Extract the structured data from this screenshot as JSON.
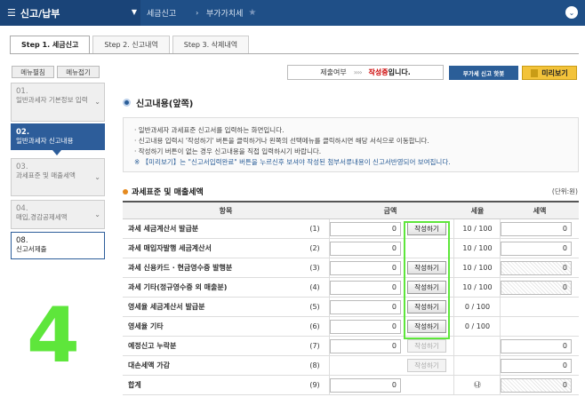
{
  "nav": {
    "menu_label": "신고/납부",
    "crumb1": "세금신고",
    "crumb2": "부가가치세"
  },
  "steps": [
    {
      "label": "Step 1. 세금신고",
      "active": true
    },
    {
      "label": "Step 2. 신고내역",
      "active": false
    },
    {
      "label": "Step 3. 삭제내역",
      "active": false
    }
  ],
  "sidebar": {
    "expand_label": "메뉴펼침",
    "collapse_label": "메뉴접기",
    "items": [
      {
        "num": "01.",
        "label": "일반과세자 기본정보 입력"
      },
      {
        "num": "02.",
        "label": "일반과세자 신고내용"
      },
      {
        "num": "03.",
        "label": "과세표준 및 매출세액"
      },
      {
        "num": "04.",
        "label": "매입,경감공제세액"
      },
      {
        "num": "08.",
        "label": "신고서제출"
      }
    ]
  },
  "overlay_number": "4",
  "status": {
    "label": "제출여부",
    "arrows": "››››",
    "state": "작성중",
    "state_suffix": "입니다."
  },
  "buttons": {
    "vat_video": "부가세 신고 핫봇",
    "preview": "미리보기"
  },
  "section_title": "신고내용(앞쪽)",
  "info": {
    "line1": "· 일반과세자 과세표준 신고서를 입력하는 화면입니다.",
    "line2": "· 신고내용 입력시 '작성하기' 버튼을 클릭하거나 왼쪽의 선택메뉴를 클릭하시면 해당 서식으로 이동합니다.",
    "line3": "· 작성하기 버튼이 없는 경우 신고내용을 직접 입력하시기 바랍니다.",
    "line4": "※ 【미리보기】는 \"신고서입력완료\" 버튼을 누르신후 보셔야 작성된 첨부서류내용이 신고서반영되어 보여집니다."
  },
  "table": {
    "title": "과세표준 및 매출세액",
    "unit": "(단위:원)",
    "headers": {
      "item": "항목",
      "amount": "금액",
      "rate": "세율",
      "tax": "세액"
    },
    "rows": [
      {
        "label": "과세 세금계산서 발급분",
        "no": "(1)",
        "amount": "0",
        "button": "작성하기",
        "button_enabled": true,
        "rate": "10 / 100",
        "tax": "0",
        "tax_hatch": false
      },
      {
        "label": "과세 매입자발행 세금계산서",
        "no": "(2)",
        "amount": "0",
        "button": "",
        "button_enabled": false,
        "rate": "10 / 100",
        "tax": "0",
        "tax_hatch": false
      },
      {
        "label": "과세 신용카드 · 현금영수증 발행분",
        "no": "(3)",
        "amount": "0",
        "button": "작성하기",
        "button_enabled": true,
        "rate": "10 / 100",
        "tax": "0",
        "tax_hatch": true
      },
      {
        "label": "과세 기타(정규영수증 외 매출분)",
        "no": "(4)",
        "amount": "0",
        "button": "작성하기",
        "button_enabled": true,
        "rate": "10 / 100",
        "tax": "0",
        "tax_hatch": true
      },
      {
        "label": "영세율 세금계산서 발급분",
        "no": "(5)",
        "amount": "0",
        "button": "작성하기",
        "button_enabled": true,
        "rate": "0 / 100",
        "tax": "",
        "tax_hatch": false
      },
      {
        "label": "영세율 기타",
        "no": "(6)",
        "amount": "0",
        "button": "작성하기",
        "button_enabled": true,
        "rate": "0 / 100",
        "tax": "",
        "tax_hatch": false
      },
      {
        "label": "예정신고 누락분",
        "no": "(7)",
        "amount": "0",
        "button": "작성하기",
        "button_enabled": false,
        "rate": "",
        "tax": "0",
        "tax_hatch": false
      },
      {
        "label": "대손세액 가감",
        "no": "(8)",
        "amount": "",
        "button": "작성하기",
        "button_enabled": false,
        "rate": "",
        "tax": "0",
        "tax_hatch": false
      },
      {
        "label": "합계",
        "no": "(9)",
        "amount": "0",
        "button": "",
        "button_enabled": false,
        "rate": "㉯",
        "tax": "0",
        "tax_hatch": true
      }
    ]
  }
}
